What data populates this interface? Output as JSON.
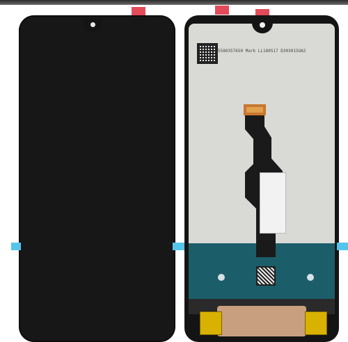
{
  "image": {
    "description": "",
    "colors": {
      "panel_black": "#171717",
      "back_gray": "#d9d9d6",
      "tab_red": "#e34b5a",
      "tab_cyan": "#55c4ea",
      "teal": "#1c5d6a",
      "chip_yellow": "#d9b100"
    },
    "back_label": {
      "serial_text": "5580357650 Mark LL180517 D303015UA2"
    }
  }
}
